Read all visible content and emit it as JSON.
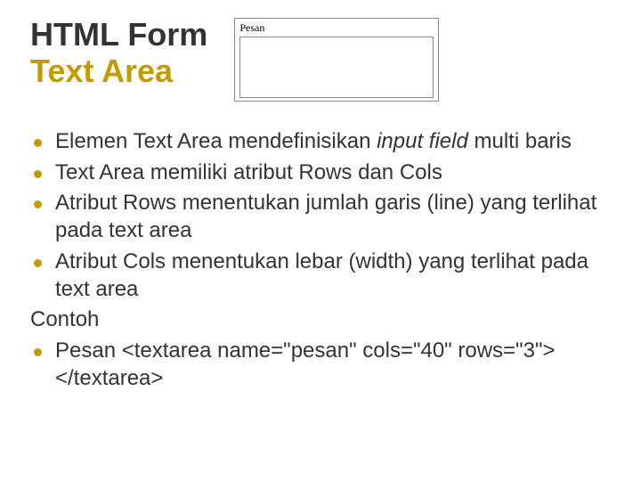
{
  "title": {
    "line1": "HTML Form",
    "line2": "Text Area"
  },
  "embed": {
    "label": "Pesan"
  },
  "bullets": {
    "b1_pre": "Elemen Text Area mendefinisikan ",
    "b1_em": "input field",
    "b1_post": " multi baris",
    "b2": "Text Area memiliki atribut Rows dan Cols",
    "b3": "Atribut Rows menentukan jumlah garis (line) yang terlihat pada text area",
    "b4": " Atribut Cols menentukan lebar (width) yang terlihat pada text area",
    "contoh": "Contoh",
    "b5": "Pesan <textarea name=\"pesan\" cols=\"40\" rows=\"3\"></textarea>"
  }
}
